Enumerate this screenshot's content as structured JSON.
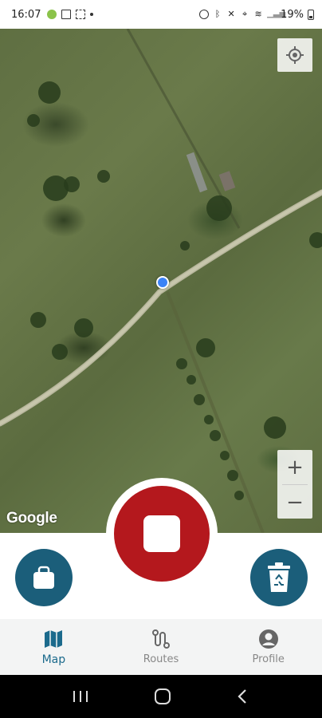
{
  "status_bar": {
    "time": "16:07",
    "battery": "19%"
  },
  "map": {
    "attribution": "Google",
    "zoom_in_label": "+",
    "zoom_out_label": "−"
  },
  "controls": {
    "record_color": "#b4181d",
    "accent_color": "#1b5e7a"
  },
  "bottom_nav": {
    "items": [
      {
        "label": "Map",
        "icon": "map-icon",
        "active": true
      },
      {
        "label": "Routes",
        "icon": "routes-icon",
        "active": false
      },
      {
        "label": "Profile",
        "icon": "profile-icon",
        "active": false
      }
    ]
  },
  "system_nav": {
    "icons": [
      "recent-apps-icon",
      "home-icon",
      "back-icon"
    ]
  }
}
